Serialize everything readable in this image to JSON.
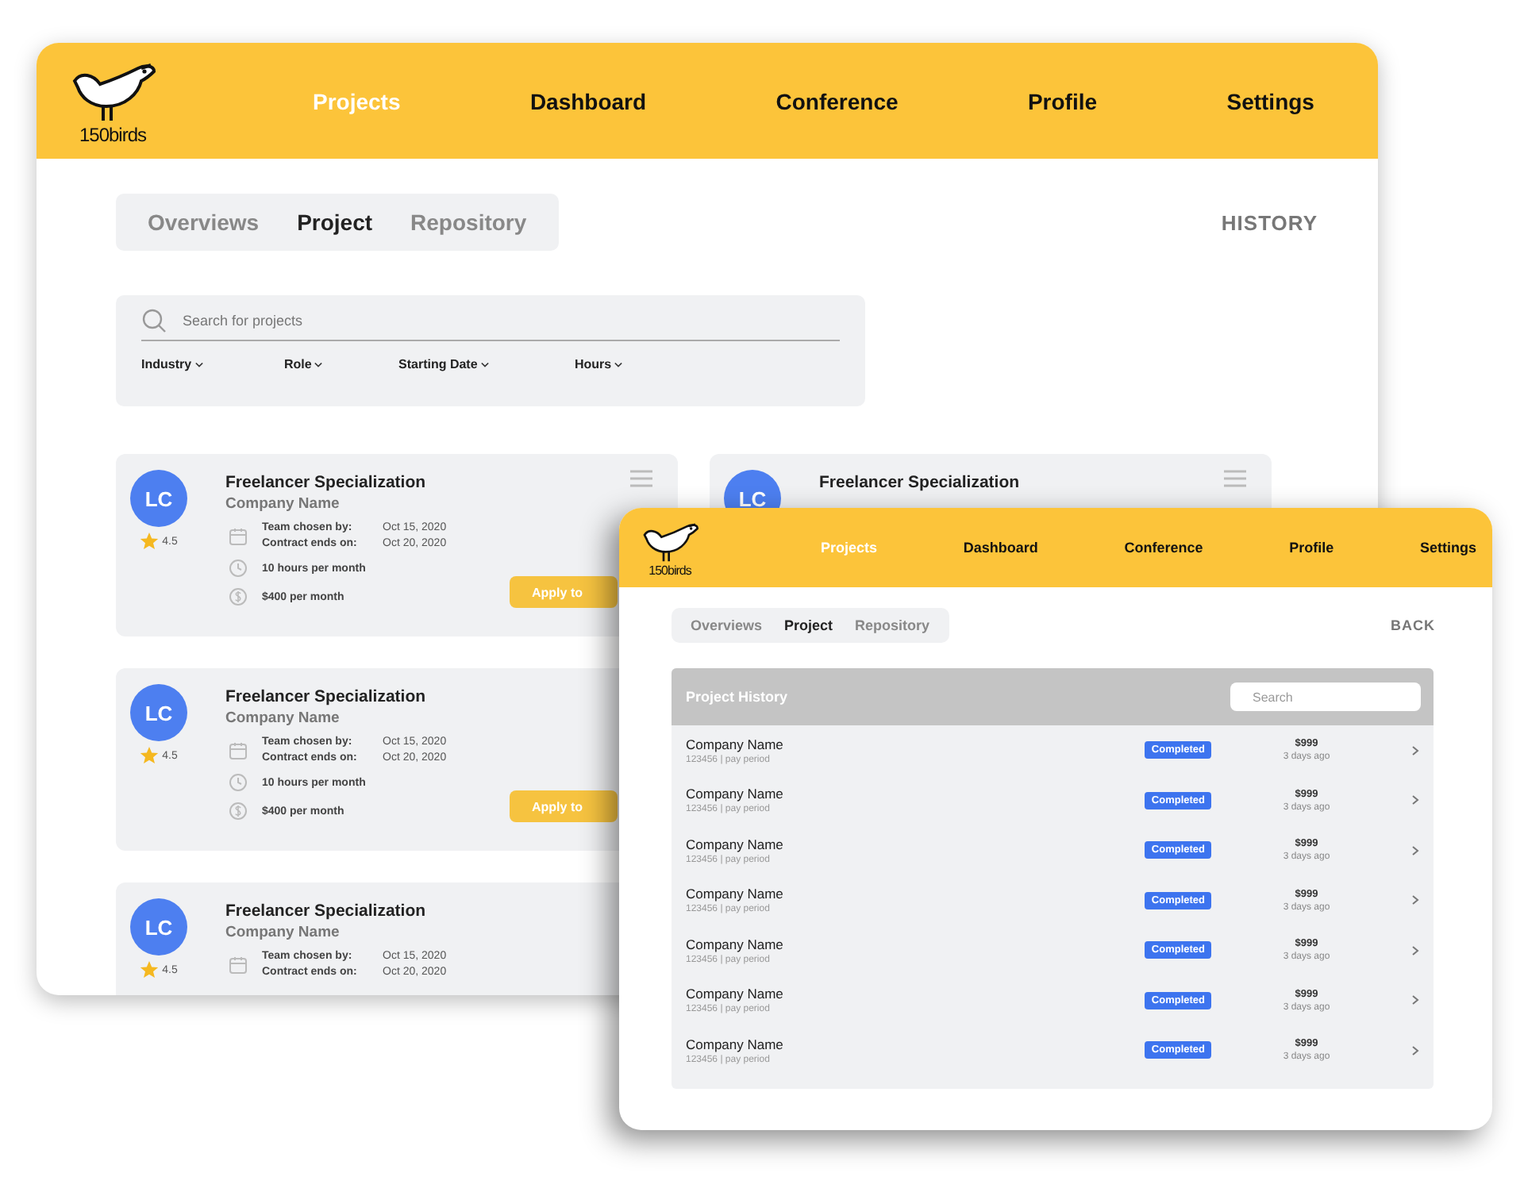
{
  "back_window": {
    "logo": "150birds",
    "nav": [
      {
        "label": "Projects",
        "selected": true
      },
      {
        "label": "Dashboard",
        "selected": false
      },
      {
        "label": "Conference",
        "selected": false
      },
      {
        "label": "Profile",
        "selected": false
      },
      {
        "label": "Settings",
        "selected": false
      }
    ],
    "tabs": [
      {
        "label": "Overviews",
        "selected": false
      },
      {
        "label": "Project",
        "selected": true
      },
      {
        "label": "Repository",
        "selected": false
      }
    ],
    "history_link": "HISTORY",
    "search": {
      "placeholder": "Search for projects"
    },
    "filters": [
      "Industry",
      "Role",
      "Starting Date",
      "Hours"
    ],
    "columns": [
      {
        "cards": [
          {
            "initials": "LC",
            "rating": "4.5",
            "title": "Freelancer Specialization",
            "company": "Company Name",
            "menu": true,
            "details": [
              {
                "kind": "dates",
                "lines": [
                  {
                    "label": "Team chosen by:",
                    "value": "Oct 15, 2020"
                  },
                  {
                    "label": "Contract ends on:",
                    "value": "Oct 20, 2020"
                  }
                ]
              },
              {
                "kind": "hours",
                "text": "10 hours per month"
              },
              {
                "kind": "pay",
                "text": "$400 per month"
              }
            ],
            "button": "Apply to"
          },
          {
            "initials": "LC",
            "rating": "4.5",
            "title": "Freelancer Specialization",
            "company": "Company Name",
            "details": [
              {
                "kind": "dates",
                "lines": [
                  {
                    "label": "Team chosen by:",
                    "value": "Oct 15, 2020"
                  },
                  {
                    "label": "Contract ends on:",
                    "value": "Oct 20, 2020"
                  }
                ]
              },
              {
                "kind": "hours",
                "text": "10 hours per month"
              },
              {
                "kind": "pay",
                "text": "$400 per month"
              }
            ],
            "button": "Apply to"
          },
          {
            "initials": "LC",
            "rating": "4.5",
            "title": "Freelancer Specialization",
            "company": "Company Name",
            "details": [
              {
                "kind": "dates",
                "lines": [
                  {
                    "label": "Team chosen by:",
                    "value": "Oct 15, 2020"
                  },
                  {
                    "label": "Contract ends on:",
                    "value": "Oct 20, 2020"
                  }
                ]
              }
            ]
          }
        ]
      },
      {
        "cards": [
          {
            "initials": "LC",
            "title": "Freelancer Specialization",
            "menu": true
          }
        ]
      }
    ]
  },
  "front_window": {
    "logo": "150birds",
    "nav": [
      {
        "label": "Projects",
        "selected": true
      },
      {
        "label": "Dashboard",
        "selected": false
      },
      {
        "label": "Conference",
        "selected": false
      },
      {
        "label": "Profile",
        "selected": false
      },
      {
        "label": "Settings",
        "selected": false
      }
    ],
    "tabs": [
      {
        "label": "Overviews",
        "selected": false
      },
      {
        "label": "Project",
        "selected": true
      },
      {
        "label": "Repository",
        "selected": false
      }
    ],
    "back_link": "BACK",
    "panel": {
      "title": "Project History",
      "search": {
        "placeholder": "Search"
      },
      "rows": [
        {
          "company": "Company Name",
          "meta": "123456 | pay period",
          "status": "Completed",
          "amount": "$999",
          "time": "3 days ago"
        },
        {
          "company": "Company Name",
          "meta": "123456 | pay period",
          "status": "Completed",
          "amount": "$999",
          "time": "3 days ago"
        },
        {
          "company": "Company Name",
          "meta": "123456 | pay period",
          "status": "Completed",
          "amount": "$999",
          "time": "3 days ago"
        },
        {
          "company": "Company Name",
          "meta": "123456 | pay period",
          "status": "Completed",
          "amount": "$999",
          "time": "3 days ago"
        },
        {
          "company": "Company Name",
          "meta": "123456 | pay period",
          "status": "Completed",
          "amount": "$999",
          "time": "3 days ago"
        },
        {
          "company": "Company Name",
          "meta": "123456 | pay period",
          "status": "Completed",
          "amount": "$999",
          "time": "3 days ago"
        },
        {
          "company": "Company Name",
          "meta": "123456 | pay period",
          "status": "Completed",
          "amount": "$999",
          "time": "3 days ago"
        }
      ]
    }
  }
}
